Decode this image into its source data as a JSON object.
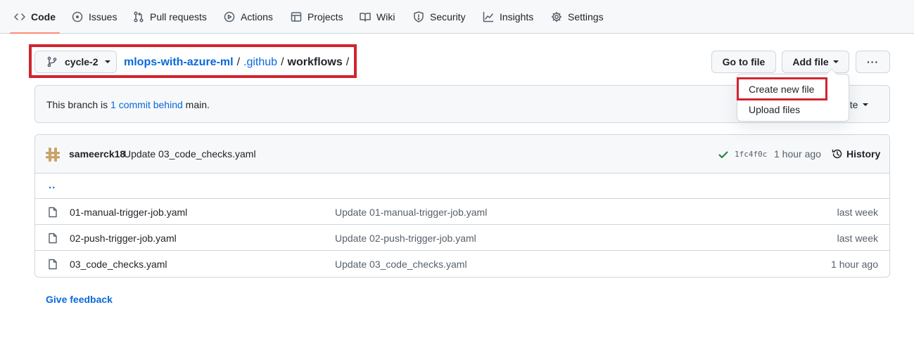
{
  "nav": {
    "items": [
      {
        "label": "Code",
        "icon": "code-icon",
        "selected": true
      },
      {
        "label": "Issues",
        "icon": "issue-circle-icon"
      },
      {
        "label": "Pull requests",
        "icon": "pull-request-icon"
      },
      {
        "label": "Actions",
        "icon": "play-circle-icon"
      },
      {
        "label": "Projects",
        "icon": "table-icon"
      },
      {
        "label": "Wiki",
        "icon": "book-icon"
      },
      {
        "label": "Security",
        "icon": "shield-icon"
      },
      {
        "label": "Insights",
        "icon": "graph-icon"
      },
      {
        "label": "Settings",
        "icon": "gear-icon"
      }
    ]
  },
  "branch": {
    "name": "cycle-2",
    "icon": "git-branch-icon"
  },
  "breadcrumb": {
    "repo": "mlops-with-azure-ml",
    "sep": "/",
    "folder": ".github",
    "current": "workflows"
  },
  "actions": {
    "go_to_file": "Go to file",
    "add_file": "Add file",
    "more": "···"
  },
  "dropdown": {
    "items": [
      "Create new file",
      "Upload files"
    ],
    "highlighted": "Create new file"
  },
  "branch_info": {
    "prefix": "This branch is",
    "link": "1 commit behind",
    "suffix": "main.",
    "contribute_partial": "ute"
  },
  "latest_commit": {
    "author": "sameerck18",
    "message": "Update 03_code_checks.yaml",
    "sha": "1fc4f0c",
    "time": "1 hour ago",
    "history_label": "History",
    "status": "success"
  },
  "parent_dir": "..",
  "files": [
    {
      "name": "01-manual-trigger-job.yaml",
      "message": "Update 01-manual-trigger-job.yaml",
      "age": "last week"
    },
    {
      "name": "02-push-trigger-job.yaml",
      "message": "Update 02-push-trigger-job.yaml",
      "age": "last week"
    },
    {
      "name": "03_code_checks.yaml",
      "message": "Update 03_code_checks.yaml",
      "age": "1 hour ago"
    }
  ],
  "feedback": "Give feedback",
  "colors": {
    "link": "#0969da",
    "annotation": "#d1242f",
    "selected_underline": "#fd8c73",
    "success": "#1a7f37"
  }
}
